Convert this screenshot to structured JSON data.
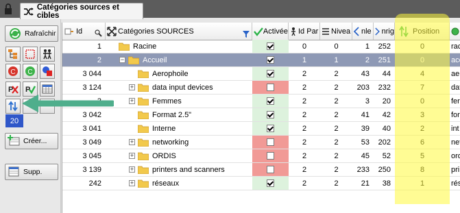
{
  "tab": {
    "title": "Catégories sources et cibles"
  },
  "toolbar": {
    "refresh_label": "Rafraîchir",
    "count_value": "20",
    "create_label": "Créer...",
    "delete_label": "Supp."
  },
  "columns": [
    {
      "key": "id",
      "label": "Id"
    },
    {
      "key": "categorie",
      "label": "Catégories SOURCES"
    },
    {
      "key": "activee",
      "label": "Activée"
    },
    {
      "key": "id_parent",
      "label": "Id Par"
    },
    {
      "key": "niveau",
      "label": "Nivea"
    },
    {
      "key": "nleft",
      "label": "nle"
    },
    {
      "key": "nright",
      "label": "nrig"
    },
    {
      "key": "position",
      "label": "Position"
    },
    {
      "key": "extra",
      "label": ""
    }
  ],
  "rows": [
    {
      "id": "1",
      "name": "Racine",
      "expander": "",
      "activee": true,
      "id_parent": "0",
      "niveau": "0",
      "nleft": "1",
      "nright": "252",
      "position": "0",
      "extra": "rac"
    },
    {
      "id": "2",
      "name": "Accueil",
      "expander": "−",
      "activee": true,
      "id_parent": "1",
      "niveau": "1",
      "nleft": "2",
      "nright": "251",
      "position": "0",
      "extra": "acc"
    },
    {
      "id": "3 044",
      "name": "Aerophoile",
      "expander": "",
      "activee": true,
      "id_parent": "2",
      "niveau": "2",
      "nleft": "43",
      "nright": "44",
      "position": "4",
      "extra": "aer"
    },
    {
      "id": "3 124",
      "name": "data input devices",
      "expander": "+",
      "activee": false,
      "id_parent": "2",
      "niveau": "2",
      "nleft": "203",
      "nright": "232",
      "position": "7",
      "extra": "dat"
    },
    {
      "id": "3",
      "name": "Femmes",
      "expander": "+",
      "activee": true,
      "id_parent": "2",
      "niveau": "2",
      "nleft": "3",
      "nright": "20",
      "position": "0",
      "extra": "fer"
    },
    {
      "id": "3 042",
      "name": "Format 2.5\"",
      "expander": "",
      "activee": true,
      "id_parent": "2",
      "niveau": "2",
      "nleft": "41",
      "nright": "42",
      "position": "3",
      "extra": "for"
    },
    {
      "id": "3 041",
      "name": "Interne",
      "expander": "",
      "activee": true,
      "id_parent": "2",
      "niveau": "2",
      "nleft": "39",
      "nright": "40",
      "position": "2",
      "extra": "int"
    },
    {
      "id": "3 049",
      "name": "networking",
      "expander": "+",
      "activee": false,
      "id_parent": "2",
      "niveau": "2",
      "nleft": "53",
      "nright": "202",
      "position": "6",
      "extra": "net"
    },
    {
      "id": "3 045",
      "name": "ORDIS",
      "expander": "+",
      "activee": false,
      "id_parent": "2",
      "niveau": "2",
      "nleft": "45",
      "nright": "52",
      "position": "5",
      "extra": "ord"
    },
    {
      "id": "3 139",
      "name": "printers and scanners",
      "expander": "+",
      "activee": false,
      "id_parent": "2",
      "niveau": "2",
      "nleft": "233",
      "nright": "250",
      "position": "8",
      "extra": "pri"
    },
    {
      "id": "242",
      "name": "réseaux",
      "expander": "+",
      "activee": true,
      "id_parent": "2",
      "niveau": "2",
      "nleft": "21",
      "nright": "38",
      "position": "1",
      "extra": "rés"
    }
  ],
  "colors": {
    "selected_row": "#8e99b5",
    "active_bg": "#ddf2dd",
    "inactive_bg": "#f19a96",
    "highlight": "#fff83a",
    "arrow": "#4fae8c"
  }
}
